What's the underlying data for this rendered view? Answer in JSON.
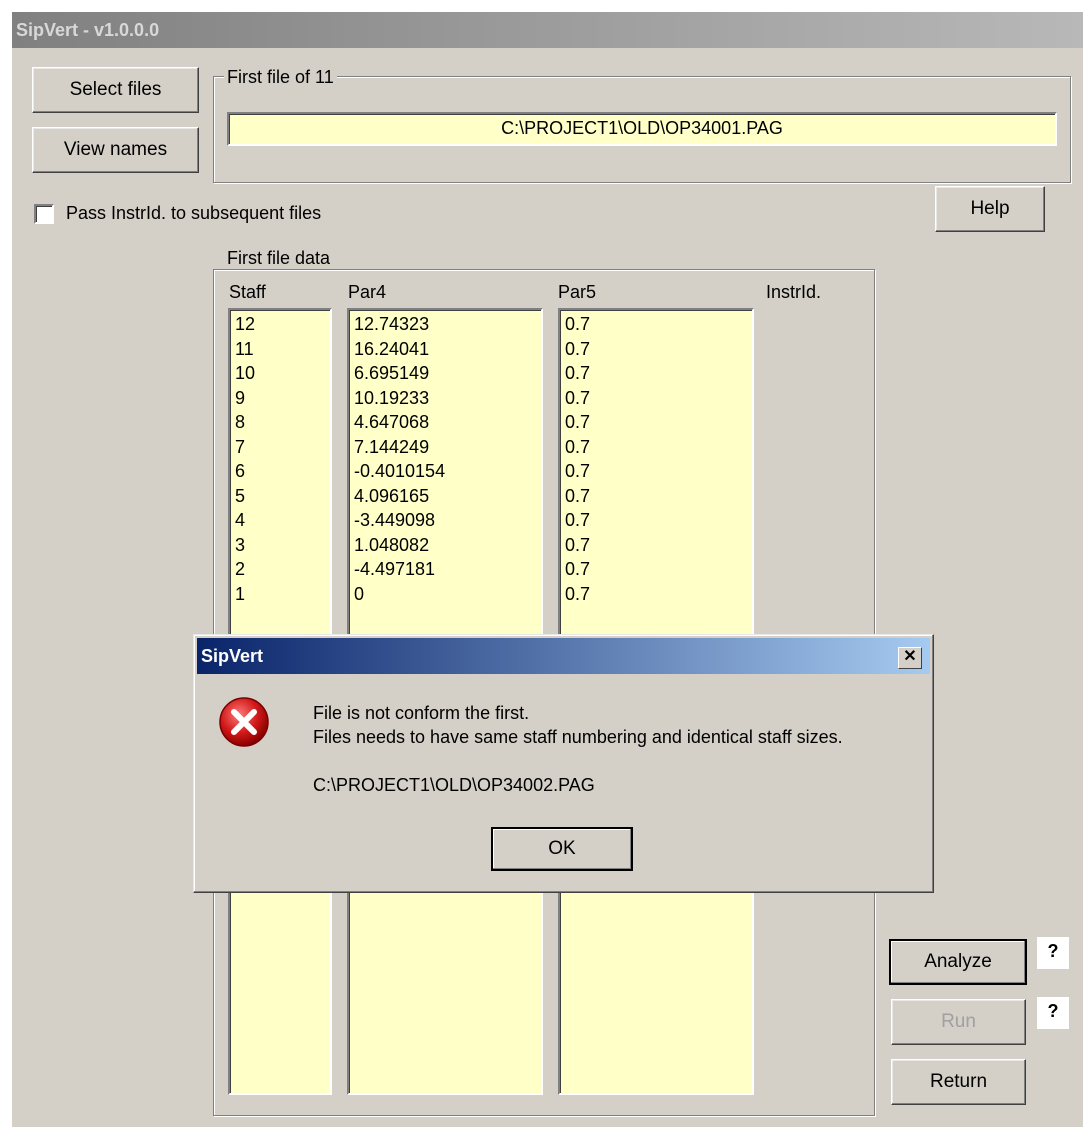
{
  "window": {
    "title": "SipVert - v1.0.0.0"
  },
  "buttons": {
    "select_files": "Select files",
    "view_names": "View names",
    "help": "Help",
    "analyze": "Analyze",
    "run": "Run",
    "return": "Return",
    "analyze_help": "?",
    "run_help": "?"
  },
  "first_file": {
    "group_label": "First file of 11",
    "path": "C:\\PROJECT1\\OLD\\OP34001.PAG"
  },
  "pass_instrid": {
    "label": "Pass InstrId. to subsequent files",
    "checked": false
  },
  "first_file_data": {
    "group_label": "First file data",
    "columns": [
      "Staff",
      "Par4",
      "Par5",
      "InstrId."
    ],
    "staff": [
      "12",
      "11",
      "10",
      "9",
      "8",
      "7",
      "6",
      "5",
      "4",
      "3",
      "2",
      "1"
    ],
    "par4": [
      "12.74323",
      "16.24041",
      "6.695149",
      "10.19233",
      "4.647068",
      "7.144249",
      "-0.4010154",
      "4.096165",
      "-3.449098",
      "1.048082",
      "-4.497181",
      "0"
    ],
    "par5": [
      "0.7",
      "0.7",
      "0.7",
      "0.7",
      "0.7",
      "0.7",
      "0.7",
      "0.7",
      "0.7",
      "0.7",
      "0.7",
      "0.7"
    ]
  },
  "dialog": {
    "title": "SipVert",
    "close_glyph": "✕",
    "line1": "File is not conform the first.",
    "line2": "Files needs to have same staff numbering and identical staff sizes.",
    "path": "C:\\PROJECT1\\OLD\\OP34002.PAG",
    "ok": "OK",
    "icon": "error-icon"
  },
  "colors": {
    "face": "#d4d0c8",
    "field": "#ffffc8",
    "dialog_title_start": "#0a246a",
    "dialog_title_end": "#a6caf0",
    "error_red": "#d01818"
  }
}
